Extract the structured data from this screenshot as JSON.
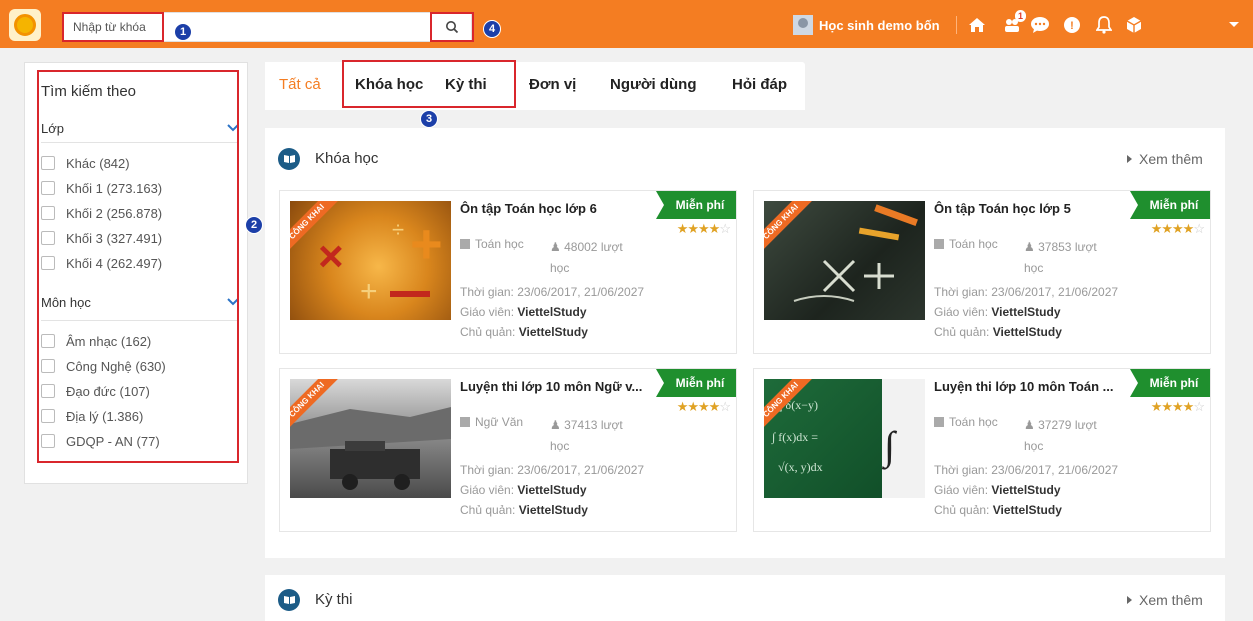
{
  "header": {
    "search_placeholder": "Nhập từ khóa",
    "user_name": "Học sinh demo bốn",
    "badge_count": "1",
    "accent": "#f47d22"
  },
  "callouts": {
    "c1": "1",
    "c2": "2",
    "c3": "3",
    "c4": "4"
  },
  "sidebar": {
    "title": "Tìm kiếm theo",
    "groups": [
      {
        "label": "Lớp",
        "options": [
          "Khác (842)",
          "Khối 1 (273.163)",
          "Khối 2 (256.878)",
          "Khối 3 (327.491)",
          "Khối 4 (262.497)"
        ]
      },
      {
        "label": "Môn học",
        "options": [
          "Âm nhạc (162)",
          "Công Nghệ (630)",
          "Đạo đức (107)",
          "Địa lý (1.386)",
          "GDQP - AN (77)"
        ]
      }
    ]
  },
  "tabs": [
    "Tất cả",
    "Khóa học",
    "Kỳ thi",
    "Đơn vị",
    "Người dùng",
    "Hỏi đáp"
  ],
  "sections": [
    {
      "title": "Khóa học",
      "more": "Xem thêm"
    },
    {
      "title": "Kỳ thi",
      "more": "Xem thêm"
    }
  ],
  "courses": [
    {
      "title": "Ôn tập Toán học lớp 6",
      "tag": "Miễn phí",
      "rating": 4,
      "ribbon": "CÔNG KHAI",
      "subject": "Toán học",
      "views": "48002 lượt học",
      "time_label": "Thời gian:",
      "time": "23/06/2017, 21/06/2027",
      "teacher_label": "Giáo viên:",
      "teacher": "ViettelStudy",
      "owner_label": "Chủ quản:",
      "owner": "ViettelStudy",
      "thumb": "math-orange"
    },
    {
      "title": "Ôn tập Toán học lớp 5",
      "tag": "Miễn phí",
      "rating": 4,
      "ribbon": "CÔNG KHAI",
      "subject": "Toán học",
      "views": "37853 lượt học",
      "time_label": "Thời gian:",
      "time": "23/06/2017, 21/06/2027",
      "teacher_label": "Giáo viên:",
      "teacher": "ViettelStudy",
      "owner_label": "Chủ quản:",
      "owner": "ViettelStudy",
      "thumb": "chalkboard"
    },
    {
      "title": "Luyện thi lớp 10 môn Ngữ v...",
      "tag": "Miễn phí",
      "rating": 4,
      "ribbon": "CÔNG KHAI",
      "subject": "Ngữ Văn",
      "views": "37413 lượt học",
      "time_label": "Thời gian:",
      "time": "23/06/2017, 21/06/2027",
      "teacher_label": "Giáo viên:",
      "teacher": "ViettelStudy",
      "owner_label": "Chủ quản:",
      "owner": "ViettelStudy",
      "thumb": "old-photo"
    },
    {
      "title": "Luyện thi lớp 10 môn Toán ...",
      "tag": "Miễn phí",
      "rating": 4,
      "ribbon": "CÔNG KHAI",
      "subject": "Toán học",
      "views": "37279 lượt học",
      "time_label": "Thời gian:",
      "time": "23/06/2017, 21/06/2027",
      "teacher_label": "Giáo viên:",
      "teacher": "ViettelStudy",
      "owner_label": "Chủ quản:",
      "owner": "ViettelStudy",
      "thumb": "green-board"
    }
  ]
}
